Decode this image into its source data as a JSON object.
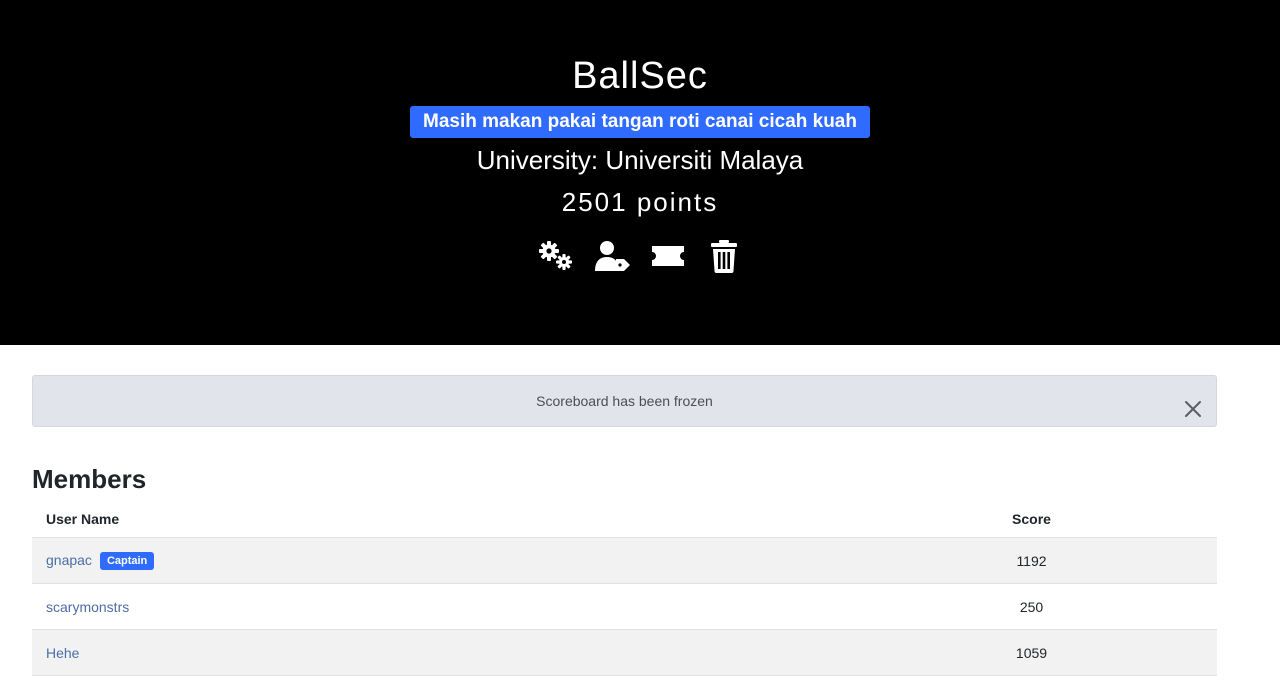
{
  "team": {
    "name": "BallSec",
    "affiliation": "Masih makan pakai tangan roti canai cicah kuah",
    "university": "University: Universiti Malaya",
    "points": "2501 points"
  },
  "actions": [
    {
      "icon": "gears-icon"
    },
    {
      "icon": "user-tag-icon"
    },
    {
      "icon": "ticket-icon"
    },
    {
      "icon": "trash-icon"
    }
  ],
  "alert": {
    "message": "Scoreboard has been frozen"
  },
  "members": {
    "title": "Members",
    "columns": {
      "name": "User Name",
      "score": "Score"
    },
    "rows": [
      {
        "name": "gnapac",
        "badge": "Captain",
        "score": "1192"
      },
      {
        "name": "scarymonstrs",
        "badge": "",
        "score": "250"
      },
      {
        "name": "Hehe",
        "badge": "",
        "score": "1059"
      }
    ]
  },
  "colors": {
    "header_bg": "#000000",
    "accent": "#2f6bff",
    "link": "#4a6ea8",
    "alert_bg": "#e1e4ea"
  }
}
